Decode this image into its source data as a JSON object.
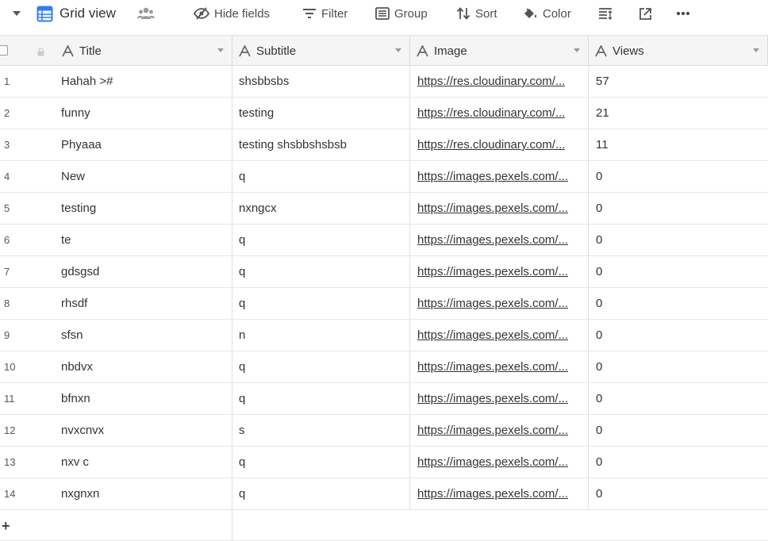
{
  "toolbar": {
    "view_name": "Grid view",
    "hide_fields": "Hide fields",
    "filter": "Filter",
    "group": "Group",
    "sort": "Sort",
    "color": "Color"
  },
  "columns": {
    "title": "Title",
    "subtitle": "Subtitle",
    "image": "Image",
    "views": "Views"
  },
  "rows": [
    {
      "n": "1",
      "title": "Hahah >#",
      "subtitle": "shsbbsbs",
      "image": "https://res.cloudinary.com/...",
      "views": "57"
    },
    {
      "n": "2",
      "title": "funny",
      "subtitle": "testing",
      "image": "https://res.cloudinary.com/...",
      "views": "21"
    },
    {
      "n": "3",
      "title": "Phyaaa",
      "subtitle": "testing shsbbshsbsb",
      "image": "https://res.cloudinary.com/...",
      "views": "11"
    },
    {
      "n": "4",
      "title": "New",
      "subtitle": "q",
      "image": "https://images.pexels.com/...",
      "views": "0"
    },
    {
      "n": "5",
      "title": "testing",
      "subtitle": "nxngcx",
      "image": "https://images.pexels.com/...",
      "views": "0"
    },
    {
      "n": "6",
      "title": "te",
      "subtitle": "q",
      "image": "https://images.pexels.com/...",
      "views": "0"
    },
    {
      "n": "7",
      "title": "gdsgsd",
      "subtitle": "q",
      "image": "https://images.pexels.com/...",
      "views": "0"
    },
    {
      "n": "8",
      "title": "rhsdf",
      "subtitle": "q",
      "image": "https://images.pexels.com/...",
      "views": "0"
    },
    {
      "n": "9",
      "title": "sfsn",
      "subtitle": "n",
      "image": "https://images.pexels.com/...",
      "views": "0"
    },
    {
      "n": "10",
      "title": "nbdvx",
      "subtitle": "q",
      "image": "https://images.pexels.com/...",
      "views": "0"
    },
    {
      "n": "11",
      "title": "bfnxn",
      "subtitle": "q",
      "image": "https://images.pexels.com/...",
      "views": "0"
    },
    {
      "n": "12",
      "title": "nvxcnvx",
      "subtitle": "s",
      "image": "https://images.pexels.com/...",
      "views": "0"
    },
    {
      "n": "13",
      "title": "nxv c",
      "subtitle": "q",
      "image": "https://images.pexels.com/...",
      "views": "0"
    },
    {
      "n": "14",
      "title": "nxgnxn",
      "subtitle": "q",
      "image": "https://images.pexels.com/...",
      "views": "0"
    }
  ],
  "add_row": "+",
  "colors": {
    "accent": "#2d7ff9",
    "icon": "#555555"
  }
}
